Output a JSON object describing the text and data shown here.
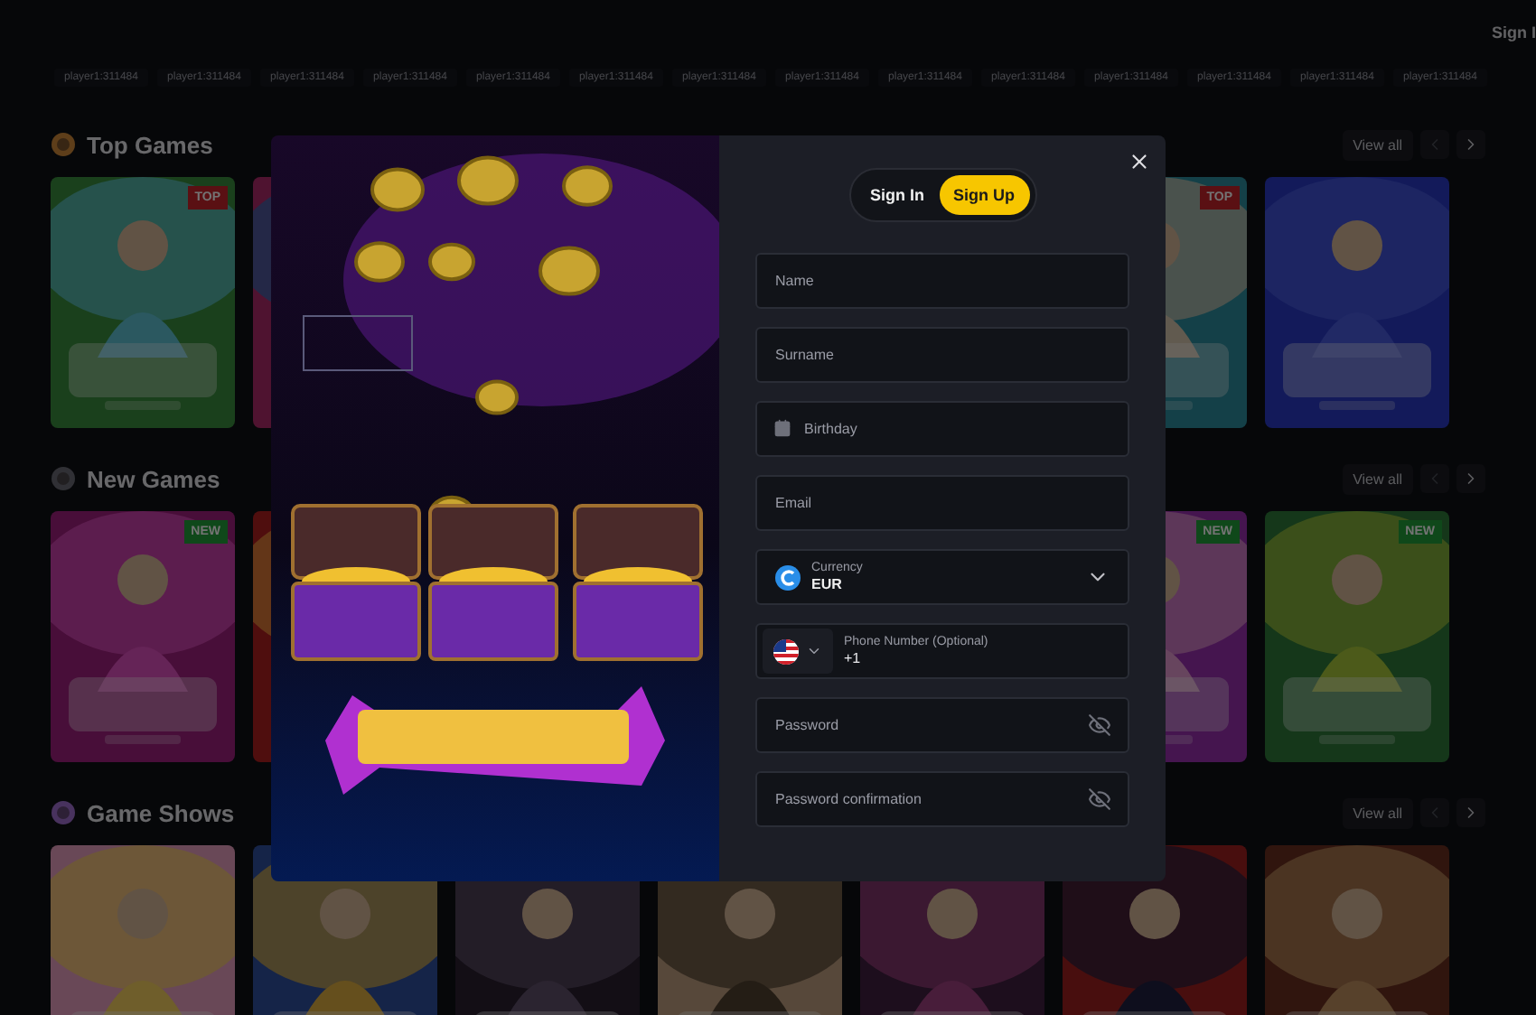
{
  "header": {
    "sign_in_link": "Sign I"
  },
  "ticker": [
    "player1:311484",
    "player1:311484",
    "player1:311484",
    "player1:311484",
    "player1:311484",
    "player1:311484",
    "player1:311484",
    "player1:311484",
    "player1:311484",
    "player1:311484",
    "player1:311484",
    "player1:311484",
    "player1:311484",
    "player1:311484"
  ],
  "sections": [
    {
      "title": "Top Games",
      "view_all": "View all",
      "prev_disabled": true,
      "cards": [
        {
          "kind": "picture",
          "badge": {
            "text": "TOP",
            "kind": "top"
          }
        },
        {
          "kind": "picture"
        },
        {
          "kind": "picture",
          "badge": {
            "text": "TOP",
            "kind": "top"
          }
        },
        {
          "kind": "picture"
        }
      ]
    },
    {
      "title": "New Games",
      "view_all": "View all",
      "prev_disabled": true,
      "cards": [
        {
          "kind": "picture",
          "badge": {
            "text": "NEW",
            "kind": "new"
          }
        },
        {
          "kind": "picture"
        },
        {
          "kind": "picture",
          "badge": {
            "text": "NEW",
            "kind": "new"
          }
        },
        {
          "kind": "picture",
          "badge": {
            "text": "NEW",
            "kind": "new"
          }
        }
      ]
    },
    {
      "title": "Game Shows",
      "view_all": "View all",
      "prev_disabled": true,
      "cards": [
        {
          "kind": "picture"
        },
        {
          "kind": "picture"
        },
        {
          "kind": "picture"
        },
        {
          "kind": "picture"
        },
        {
          "kind": "picture"
        },
        {
          "kind": "picture"
        },
        {
          "kind": "picture"
        }
      ]
    }
  ],
  "modal": {
    "promo": {
      "kind": "picture"
    },
    "tabs": [
      {
        "label": "Sign In",
        "selected": false
      },
      {
        "label": "Sign Up",
        "selected": true
      }
    ],
    "fields": [
      {
        "kind": "text",
        "placeholder": "Name"
      },
      {
        "kind": "text",
        "placeholder": "Surname"
      },
      {
        "kind": "date",
        "placeholder": "Birthday"
      },
      {
        "kind": "text",
        "placeholder": "Email"
      },
      {
        "kind": "select",
        "label": "Currency",
        "value": "EUR"
      },
      {
        "kind": "phone",
        "label": "Phone Number (Optional)",
        "value": "+1"
      },
      {
        "kind": "password",
        "placeholder": "Password"
      },
      {
        "kind": "password",
        "placeholder": "Password confirmation"
      }
    ]
  }
}
